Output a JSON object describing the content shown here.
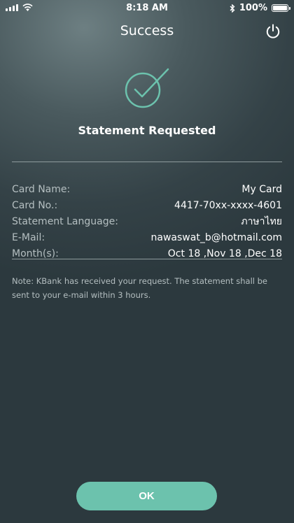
{
  "status_bar": {
    "time": "8:18 AM",
    "battery": "100%",
    "icons": [
      "signal-icon",
      "wifi-icon",
      "bluetooth-icon",
      "battery-icon"
    ]
  },
  "header": {
    "title": "Success",
    "power_icon": "power-icon"
  },
  "confirmation": {
    "icon": "check-circle-icon",
    "heading": "Statement Requested",
    "accent_color": "#6cc2ad"
  },
  "details": [
    {
      "label": "Card Name:",
      "value": "My Card"
    },
    {
      "label": "Card No.:",
      "value": "4417-70xx-xxxx-4601"
    },
    {
      "label": "Statement Language:",
      "value": "ภาษาไทย"
    },
    {
      "label": "E-Mail:",
      "value": "nawaswat_b@hotmail.com"
    },
    {
      "label": "Month(s):",
      "value": "Oct 18 ,Nov 18 ,Dec 18"
    }
  ],
  "note": "Note: KBank has received your request. The statement shall be sent to your e-mail within 3 hours.",
  "ok_button": {
    "label": "OK"
  }
}
